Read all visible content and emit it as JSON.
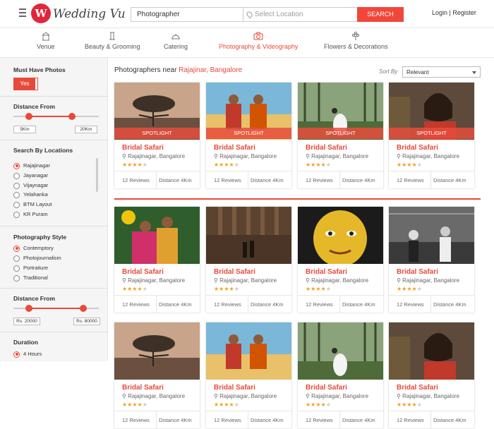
{
  "header": {
    "logo_letter": "W",
    "logo_text": "Wedding Vu",
    "category_value": "Photographer",
    "location_placeholder": "Select Location",
    "search_label": "SEARCH",
    "login_label": "Login | Register"
  },
  "tabs": [
    {
      "label": "Venue",
      "icon": "venue-icon"
    },
    {
      "label": "Beauty & Grooming",
      "icon": "beauty-icon"
    },
    {
      "label": "Catering",
      "icon": "catering-icon"
    },
    {
      "label": "Photography & Videography",
      "icon": "camera-icon",
      "active": true
    },
    {
      "label": "Flowers & Decorations",
      "icon": "flower-icon"
    }
  ],
  "sidebar": {
    "must_have_title": "Must Have Photos",
    "must_have_toggle": "Yes",
    "distance_title": "Distance From",
    "distance_min": "5Km",
    "distance_max": "20Km",
    "locations_title": "Search By Locations",
    "locations": [
      "Rajajinagar",
      "Jayanagar",
      "Vijaynagar",
      "Yelahanka",
      "BTM Layout",
      "KR Puram"
    ],
    "style_title": "Photography Style",
    "styles": [
      "Contemptory",
      "Photojournalism",
      "Portraiture",
      "Traditional"
    ],
    "price_title": "Distance From",
    "price_min": "Rs. 20000",
    "price_max": "Rs. 80000",
    "duration_title": "Duration",
    "duration_first": "4 Hours"
  },
  "main": {
    "heading_prefix": "Photographers near ",
    "heading_location": "Rajajinar, Bangalore",
    "sort_label": "Sort By",
    "sort_value": "Relevant",
    "spotlight_label": "SPOTLIGHT",
    "card_name": "Bridal Safari",
    "card_location": "Rajajinagar, Bangalore",
    "card_reviews": "12 Reviews",
    "card_distance": "Distance 4Km",
    "card_rating": 4
  },
  "colors": {
    "accent": "#e84a3a",
    "brand": "#e0273a"
  }
}
